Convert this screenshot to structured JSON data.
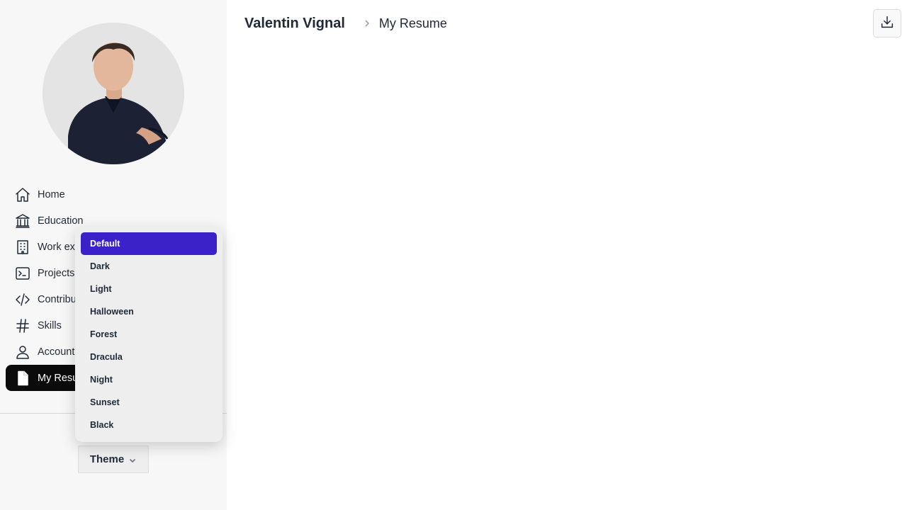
{
  "header": {
    "name": "Valentin Vignal",
    "breadcrumb": "My Resume",
    "download_icon": "download-icon"
  },
  "sidebar": {
    "avatar_icon": "profile-photo",
    "items": [
      {
        "label": "Home",
        "icon": "home-icon"
      },
      {
        "label": "Education",
        "icon": "bank-icon"
      },
      {
        "label": "Work ex",
        "icon": "building-icon"
      },
      {
        "label": "Projects",
        "icon": "terminal-icon"
      },
      {
        "label": "Contribu",
        "icon": "code-icon"
      },
      {
        "label": "Skills",
        "icon": "hash-icon"
      },
      {
        "label": "Account",
        "icon": "user-icon"
      },
      {
        "label": "My Resu",
        "icon": "document-icon",
        "active": true
      }
    ]
  },
  "theme": {
    "button_label": "Theme",
    "options": [
      "Default",
      "Dark",
      "Light",
      "Halloween",
      "Forest",
      "Dracula",
      "Night",
      "Sunset",
      "Black"
    ],
    "selected": "Default"
  },
  "colors": {
    "accent": "#3b22c8",
    "active_nav": "#0b0b0b",
    "sidebar_bg": "#f7f7f7"
  }
}
